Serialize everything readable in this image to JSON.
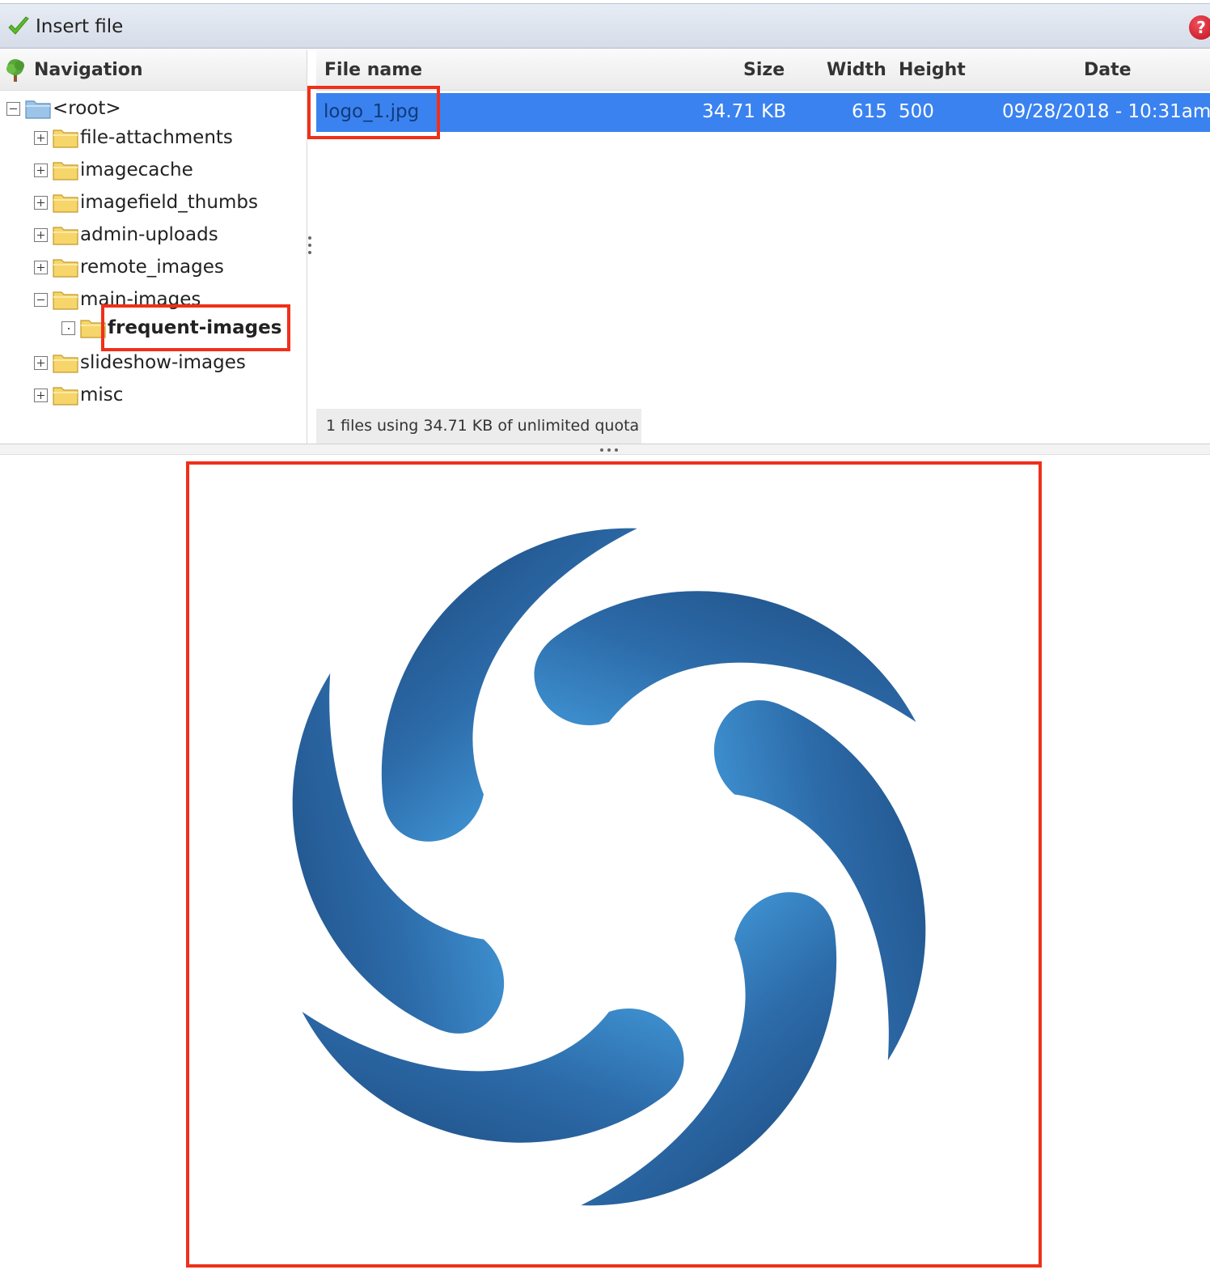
{
  "toolbar": {
    "insert_label": "Insert file",
    "insert_icon": "checkmark-icon",
    "help_icon": "help-icon",
    "help_glyph": "?"
  },
  "navigation": {
    "title": "Navigation",
    "icon": "tree-icon",
    "tree": [
      {
        "label": "<root>",
        "toggle": "minus",
        "level": 0
      },
      {
        "label": "file-attachments",
        "toggle": "plus",
        "level": 1
      },
      {
        "label": "imagecache",
        "toggle": "plus",
        "level": 1
      },
      {
        "label": "imagefield_thumbs",
        "toggle": "plus",
        "level": 1
      },
      {
        "label": "admin-uploads",
        "toggle": "plus",
        "level": 1
      },
      {
        "label": "remote_images",
        "toggle": "plus",
        "level": 1
      },
      {
        "label": "main-images",
        "toggle": "minus",
        "level": 1
      },
      {
        "label": "frequent-images",
        "toggle": "dot",
        "level": 2,
        "selected": true
      },
      {
        "label": "slideshow-images",
        "toggle": "plus",
        "level": 1
      },
      {
        "label": "misc",
        "toggle": "plus",
        "level": 1
      }
    ]
  },
  "file_list": {
    "columns": {
      "name": "File name",
      "size": "Size",
      "width": "Width",
      "height": "Height",
      "date": "Date"
    },
    "rows": [
      {
        "name": "logo_1.jpg",
        "size": "34.71 KB",
        "width": "615",
        "height": "500",
        "date": "09/28/2018 - 10:31am",
        "selected": true
      }
    ],
    "status": "1 files using 34.71 KB of unlimited quota"
  },
  "preview": {
    "image": "swirl-logo",
    "colors": {
      "light": "#3f92d2",
      "dark": "#215589"
    }
  },
  "colors": {
    "selection": "#3a82f0",
    "highlight": "#f0301a"
  }
}
